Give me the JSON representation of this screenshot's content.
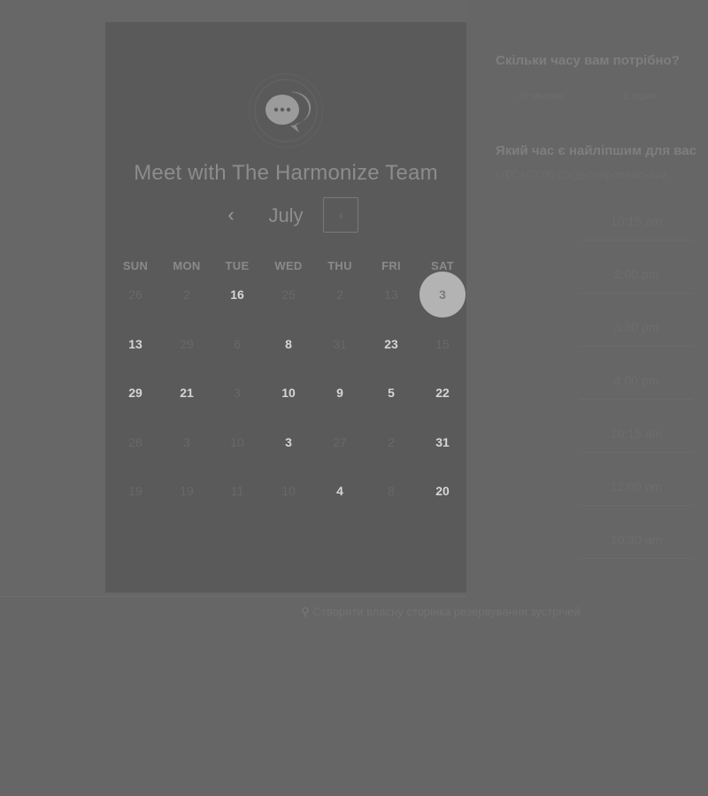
{
  "panel": {
    "title": "Meet with The Harmonize Team",
    "month": "July",
    "prev_label": "‹",
    "next_label": "›"
  },
  "weekdays": [
    "SUN",
    "MON",
    "TUE",
    "WED",
    "THU",
    "FRI",
    "SAT"
  ],
  "weeks": [
    [
      {
        "d": "26",
        "active": false
      },
      {
        "d": "2",
        "active": false
      },
      {
        "d": "16",
        "active": true
      },
      {
        "d": "25",
        "active": false
      },
      {
        "d": "2",
        "active": false
      },
      {
        "d": "13",
        "active": false
      },
      {
        "d": "3",
        "active": true,
        "selected": true
      }
    ],
    [
      {
        "d": "13",
        "active": true
      },
      {
        "d": "29",
        "active": false
      },
      {
        "d": "6",
        "active": false
      },
      {
        "d": "8",
        "active": true
      },
      {
        "d": "31",
        "active": false
      },
      {
        "d": "23",
        "active": true
      },
      {
        "d": "15",
        "active": false
      }
    ],
    [
      {
        "d": "29",
        "active": true
      },
      {
        "d": "21",
        "active": true
      },
      {
        "d": "3",
        "active": false
      },
      {
        "d": "10",
        "active": true
      },
      {
        "d": "9",
        "active": true
      },
      {
        "d": "5",
        "active": true
      },
      {
        "d": "22",
        "active": true
      }
    ],
    [
      {
        "d": "28",
        "active": false
      },
      {
        "d": "3",
        "active": false
      },
      {
        "d": "10",
        "active": false
      },
      {
        "d": "3",
        "active": true
      },
      {
        "d": "27",
        "active": false
      },
      {
        "d": "2",
        "active": false
      },
      {
        "d": "31",
        "active": true
      }
    ],
    [
      {
        "d": "19",
        "active": false
      },
      {
        "d": "19",
        "active": false
      },
      {
        "d": "11",
        "active": false
      },
      {
        "d": "10",
        "active": false
      },
      {
        "d": "4",
        "active": true
      },
      {
        "d": "8",
        "active": false
      },
      {
        "d": "20",
        "active": true
      }
    ]
  ],
  "duration": {
    "question": "Скільки часу вам потрібно?",
    "options": [
      "30 хвилин",
      "1 годин"
    ]
  },
  "times": {
    "question": "Який час є найліпшим для вас",
    "timezone": "UTC+02:00 Східноєвропейський",
    "slots": [
      "10:15 am",
      "2:00 pm",
      "3:30 pm",
      "4:00 pm",
      "10:15 am",
      "12:00 pm",
      "10:30 am"
    ]
  },
  "footer": {
    "link": "Створити власну сторінка резервування зустрічей"
  }
}
